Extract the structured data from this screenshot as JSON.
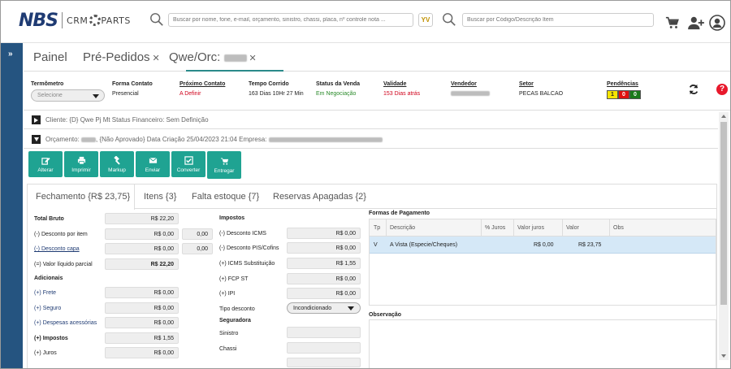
{
  "header": {
    "logo_main": "NBS",
    "logo_sub": "CRM",
    "logo_sub2": "PARTS",
    "search_placeholder": "Buscar por nome, fone, e-mail, orçamento, sinistro, chassi, placa, nº controle nota ...",
    "badge_label": "YV",
    "product_search_placeholder": "Buscar por Código/Descrição Item"
  },
  "tabs": [
    {
      "label": "Painel"
    },
    {
      "label": "Pré-Pedidos"
    },
    {
      "label": "Qwe/Orc:"
    }
  ],
  "info": {
    "termometro_label": "Termômetro",
    "termometro_value": "Selecione",
    "forma_contato_label": "Forma Contato",
    "forma_contato_value": "Presencial",
    "proximo_contato_label": "Próximo Contato",
    "proximo_contato_value": "A Definir",
    "tempo_corrido_label": "Tempo Corrido",
    "tempo_corrido_value": "163 Dias 10Hr 27 Min",
    "status_venda_label": "Status da Venda",
    "status_venda_value": "Em Negociação",
    "validade_label": "Validade",
    "validade_value": "153 Dias atrás",
    "vendedor_label": "Vendedor",
    "setor_label": "Setor",
    "setor_value": "PECAS BALCAO",
    "pendencias_label": "Pendências",
    "pendencias": [
      "1",
      "0",
      "0"
    ]
  },
  "cliente_row": "Cliente: {D} Qwe Pj Mt Status Financeiro: Sem Definição",
  "orcamento_row": {
    "prefix": "Orçamento:",
    "middle": ", {Não Aprovado} Data Criação 25/04/2023 21:04 Empresa:"
  },
  "actions": {
    "alterar": "Alterar",
    "imprimir": "Imprimir",
    "markup": "Markup",
    "enviar": "Enviar",
    "converter": "Converter",
    "entregar": "Entregar"
  },
  "subtabs": [
    {
      "label": "Fechamento {R$ 23,75}"
    },
    {
      "label": "Itens {3}"
    },
    {
      "label": "Falta estoque {7}"
    },
    {
      "label": "Reservas Apagadas {2}"
    }
  ],
  "totals": {
    "total_bruto_label": "Total Bruto",
    "total_bruto": "R$ 22,20",
    "desconto_item_label": "(-) Desconto por item",
    "desconto_item": "R$ 0,00",
    "desconto_item_pct": "0,00",
    "desconto_capa_label": "(-) Desconto capa",
    "desconto_capa": "R$ 0,00",
    "desconto_capa_pct": "0,00",
    "valor_liquido_label": "(=) Valor líquido parcial",
    "valor_liquido": "R$ 22,20",
    "adicionais_label": "Adicionais",
    "frete_label": "(+) Frete",
    "frete": "R$ 0,00",
    "seguro_label": "(+) Seguro",
    "seguro": "R$ 0,00",
    "despesas_label": "(+) Despesas acessórias",
    "despesas": "R$ 0,00",
    "impostos_label": "(+) Impostos",
    "impostos": "R$ 1,55",
    "juros_label": "(+) Juros",
    "juros": "R$ 0,00"
  },
  "impostos": {
    "title": "Impostos",
    "desconto_icms_label": "(-) Desconto ICMS",
    "desconto_icms": "R$ 0,00",
    "desconto_pis_label": "(-) Desconto PIS/Cofins",
    "desconto_pis": "R$ 0,00",
    "icms_st_label": "(+) ICMS Substituição",
    "icms_st": "R$ 1,55",
    "fcp_st_label": "(+) FCP ST",
    "fcp_st": "R$ 0,00",
    "ipi_label": "(+) IPI",
    "ipi": "R$ 0,00",
    "tipo_desconto_label": "Tipo desconto",
    "tipo_desconto": "Incondicionado",
    "seguradora_label": "Seguradora",
    "sinistro_label": "Sinistro",
    "chassi_label": "Chassi"
  },
  "payment": {
    "title": "Formas de Pagamento",
    "columns": [
      "Tp",
      "Descrição",
      "% Juros",
      "Valor juros",
      "Valor",
      "Obs"
    ],
    "rows": [
      {
        "tp": "V",
        "descricao": "A Vista (Especie/Cheques)",
        "juros_pct": "",
        "valor_juros": "R$ 0,00",
        "valor": "R$ 23,75",
        "obs": ""
      }
    ]
  },
  "observacao_label": "Observação"
}
